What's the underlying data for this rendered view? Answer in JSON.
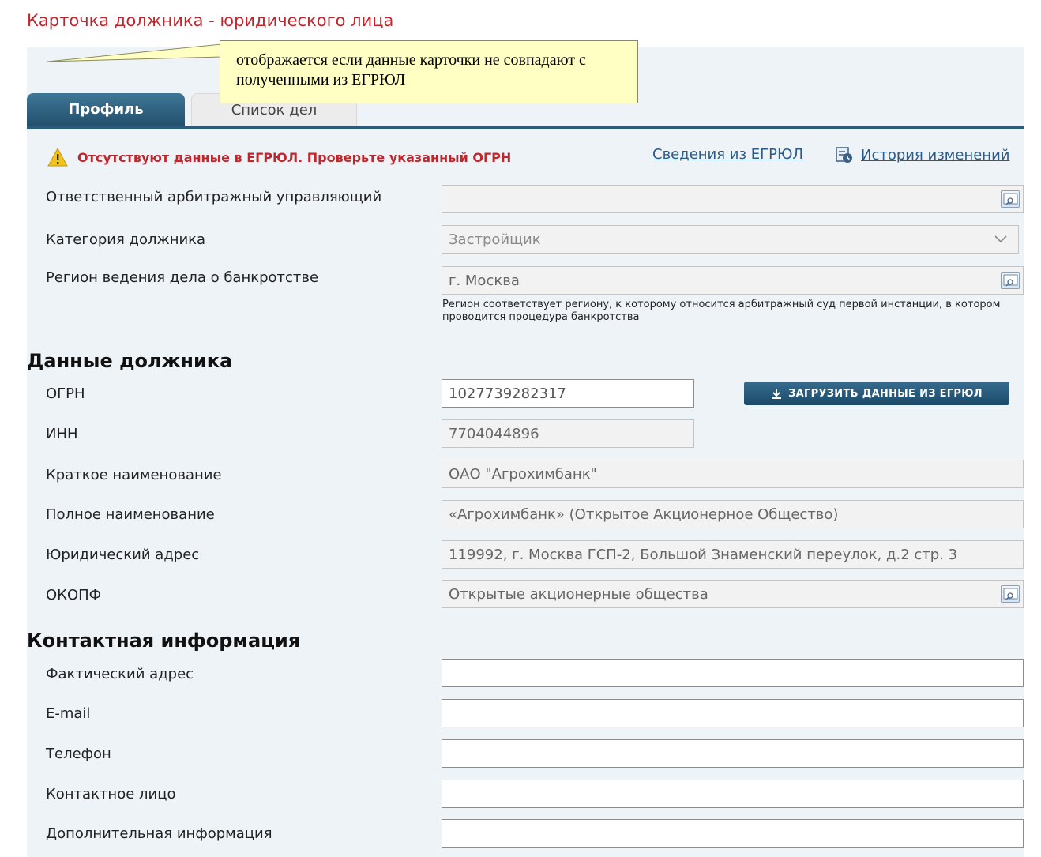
{
  "page": {
    "title": "Карточка должника - юридического лица"
  },
  "callout": {
    "text": "отображается если данные карточки не совпадают с полученными из ЕГРЮЛ"
  },
  "tabs": [
    {
      "label": "Профиль",
      "active": true
    },
    {
      "label": "Список дел",
      "active": false
    }
  ],
  "warning": {
    "text": "Отсутствуют данные в ЕГРЮЛ. Проверьте указанный ОГРН",
    "icon": "warning-icon"
  },
  "links": {
    "egrul": "Сведения из ЕГРЮЛ",
    "history": "История изменений"
  },
  "general": {
    "manager_label": "Ответственный арбитражный управляющий",
    "manager_value": "",
    "category_label": "Категория должника",
    "category_value": "Застройщик",
    "region_label": "Регион ведения дела о банкротстве",
    "region_value": "г. Москва",
    "region_hint": "Регион соответствует региону, к которому относится арбитражный суд первой инстанции, в котором проводится процедура банкротства"
  },
  "debtor": {
    "section_title": "Данные должника",
    "ogrn_label": "ОГРН",
    "ogrn_value": "1027739282317",
    "load_button": "ЗАГРУЗИТЬ ДАННЫЕ ИЗ ЕГРЮЛ",
    "inn_label": "ИНН",
    "inn_value": "7704044896",
    "short_name_label": "Краткое наименование",
    "short_name_value": "ОАО \"Агрохимбанк\"",
    "full_name_label": "Полное наименование",
    "full_name_value": "«Агрохимбанк» (Открытое Акционерное Общество)",
    "address_label": "Юридический адрес",
    "address_value": "119992, г. Москва ГСП-2, Большой Знаменский переулок, д.2 стр. 3",
    "okopf_label": "ОКОПФ",
    "okopf_value": "Открытые акционерные общества"
  },
  "contacts": {
    "section_title": "Контактная информация",
    "actual_address_label": "Фактический адрес",
    "email_label": "E-mail",
    "phone_label": "Телефон",
    "contact_person_label": "Контактное лицо",
    "additional_info_label": "Дополнительная информация"
  },
  "colors": {
    "title_red": "#c0272d",
    "tab_active": "#2a5b7a",
    "panel_bg": "#eef3f8",
    "link": "#2a5b8a",
    "callout_bg": "#ffffc4"
  }
}
